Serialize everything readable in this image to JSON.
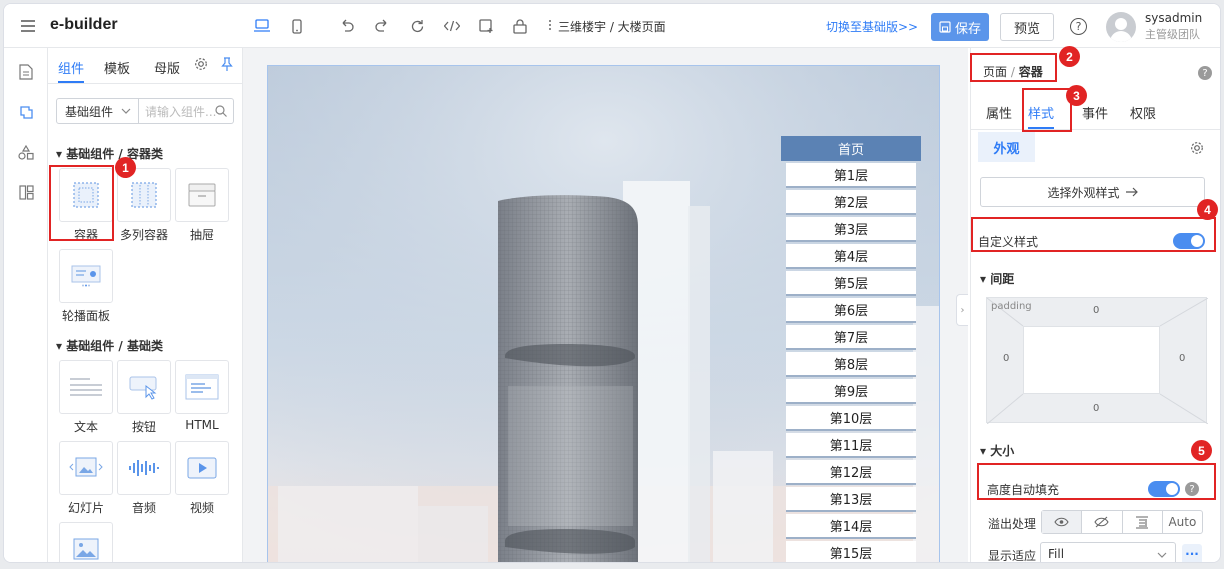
{
  "app": {
    "brand": "e-builder",
    "breadcrumb": "三维楼宇 / 大楼页面",
    "switch_link": "切换至基础版>>",
    "save_label": "保存",
    "preview_label": "预览"
  },
  "user": {
    "name": "sysadmin",
    "role": "主管级团队"
  },
  "left_panel": {
    "tabs": [
      "组件",
      "模板",
      "母版"
    ],
    "filter_select": "基础组件",
    "search_placeholder": "请输入组件...",
    "groups": [
      {
        "title": "基础组件 / 容器类",
        "items": [
          "容器",
          "多列容器",
          "抽屉",
          "轮播面板"
        ]
      },
      {
        "title": "基础组件 / 基础类",
        "items": [
          "文本",
          "按钮",
          "HTML",
          "幻灯片",
          "音频",
          "视频"
        ]
      }
    ]
  },
  "canvas": {
    "floor_header": "首页",
    "floors": [
      "第1层",
      "第2层",
      "第3层",
      "第4层",
      "第5层",
      "第6层",
      "第7层",
      "第8层",
      "第9层",
      "第10层",
      "第11层",
      "第12层",
      "第13层",
      "第14层",
      "第15层"
    ]
  },
  "right_panel": {
    "crumb_page": "页面",
    "crumb_sep": "/",
    "crumb_current": "容器",
    "tabs": [
      "属性",
      "样式",
      "事件",
      "权限"
    ],
    "subtab": "外观",
    "select_style": "选择外观样式",
    "custom_style_label": "自定义样式",
    "custom_style_on": true,
    "spacing_title": "间距",
    "padding_label": "padding",
    "padding": {
      "top": "0",
      "right": "0",
      "bottom": "0",
      "left": "0"
    },
    "size_title": "大小",
    "auto_height_label": "高度自动填充",
    "auto_height_on": true,
    "overflow_label": "溢出处理",
    "overflow_auto": "Auto",
    "display_label": "显示适应",
    "display_value": "Fill"
  },
  "callouts": [
    "1",
    "2",
    "3",
    "4",
    "5"
  ],
  "colors": {
    "accent": "#2f7cf6",
    "callout": "#e12424",
    "floor_header": "#5b82b4"
  }
}
